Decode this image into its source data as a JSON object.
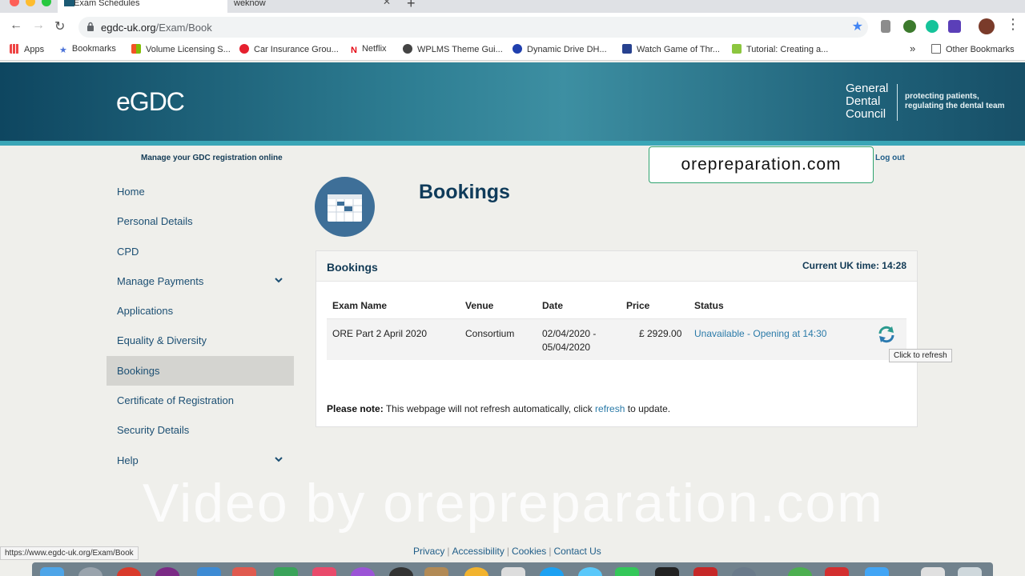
{
  "browser": {
    "tabs": [
      {
        "title": "Exam Schedules",
        "active": true
      },
      {
        "title": "weknow",
        "active": false
      }
    ],
    "url_domain": "egdc-uk.org",
    "url_path": "/Exam/Book",
    "bookmarks": [
      {
        "label": "Apps",
        "icon": "apps-grid-icon"
      },
      {
        "label": "Bookmarks",
        "icon": "star-icon"
      },
      {
        "label": "Volume Licensing S...",
        "icon": "windows-icon"
      },
      {
        "label": "Car Insurance Grou...",
        "icon": "huawei-icon"
      },
      {
        "label": "Netflix",
        "icon": "netflix-icon"
      },
      {
        "label": "WPLMS Theme Gui...",
        "icon": "globe-icon"
      },
      {
        "label": "Dynamic Drive DH...",
        "icon": "dynamic-drive-icon"
      },
      {
        "label": "Watch Game of Thr...",
        "icon": "film-icon"
      },
      {
        "label": "Tutorial: Creating a...",
        "icon": "cube-icon"
      }
    ],
    "more": "»",
    "other_bookmarks": "Other Bookmarks",
    "status_url": "https://www.egdc-uk.org/Exam/Book"
  },
  "header": {
    "logo": "eGDC",
    "org_line1": "General",
    "org_line2": "Dental",
    "org_line3": "Council",
    "tagline_line1": "protecting patients,",
    "tagline_line2": "regulating the dental team"
  },
  "topbar": {
    "manage_text": "Manage your GDC registration online",
    "watermark_box": "orepreparation.com",
    "logout": "Log out"
  },
  "sidebar": {
    "items": [
      {
        "label": "Home"
      },
      {
        "label": "Personal Details"
      },
      {
        "label": "CPD"
      },
      {
        "label": "Manage Payments"
      },
      {
        "label": "Applications"
      },
      {
        "label": "Equality & Diversity"
      },
      {
        "label": "Bookings"
      },
      {
        "label": "Certificate of Registration"
      },
      {
        "label": "Security Details"
      },
      {
        "label": "Help"
      }
    ]
  },
  "page": {
    "title": "Bookings",
    "panel_title": "Bookings",
    "uk_time_label": "Current UK time: 14:28",
    "columns": [
      "Exam Name",
      "Venue",
      "Date",
      "Price",
      "Status"
    ],
    "rows": [
      {
        "exam_name": "ORE Part 2 April 2020",
        "venue": "Consortium",
        "date_line1": "02/04/2020 -",
        "date_line2": "05/04/2020",
        "price": "£ 2929.00",
        "status": "Unavailable - Opening at 14:30"
      }
    ],
    "tooltip": "Click to refresh",
    "note_bold": "Please note:",
    "note_text": " This webpage will not refresh automatically, click ",
    "note_link": "refresh",
    "note_end": " to update."
  },
  "overlay": {
    "video_watermark": "Video by orepreparation.com"
  },
  "footer": {
    "links": [
      "Privacy",
      "Accessibility",
      "Cookies",
      "Contact Us"
    ]
  },
  "colors": {
    "brand_dark": "#0e4660",
    "brand_teal": "#3aa6b7",
    "link": "#2a7aa8",
    "nav_text": "#1c4f73"
  }
}
